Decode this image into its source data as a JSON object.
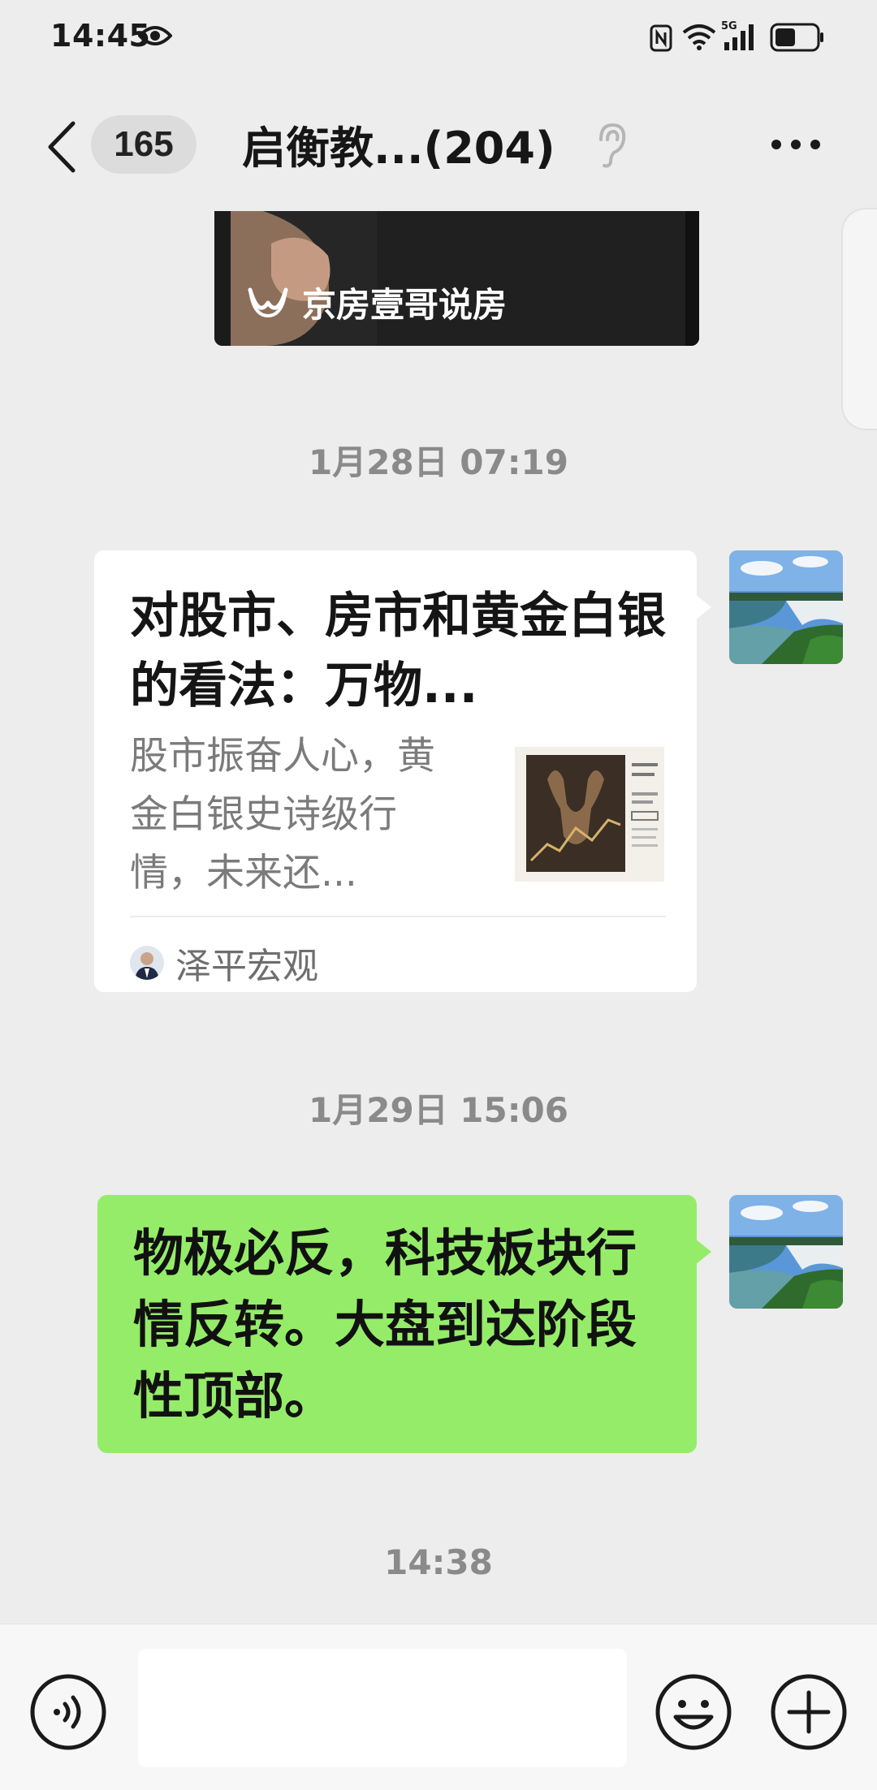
{
  "status_bar": {
    "time": "14:45",
    "network": "5G",
    "icons": [
      "eye-icon",
      "nfc-icon",
      "wifi-icon",
      "signal-icon",
      "battery-icon"
    ],
    "battery_level": 0.5
  },
  "header": {
    "unread_count": "165",
    "title": "启衡教...(204)",
    "icons": [
      "back-icon",
      "ear-icon",
      "more-icon"
    ]
  },
  "messages": {
    "video": {
      "channel_name": "京房壹哥说房",
      "icon": "channels-icon"
    },
    "time_1": "1月28日 07:19",
    "article": {
      "title": "对股市、房市和黄金白银的看法：万物...",
      "summary": "股市振奋人心，黄金白银史诗级行情，未来还...",
      "source": "泽平宏观"
    },
    "time_2": "1月29日 15:06",
    "text_message": "物极必反，科技板块行情反转。大盘到达阶段性顶部。",
    "time_3": "14:38"
  },
  "input_bar": {
    "icons": [
      "voice-icon",
      "emoji-icon",
      "plus-icon"
    ]
  },
  "colors": {
    "background": "#ededed",
    "bubble_green": "#95ec69",
    "card_white": "#ffffff",
    "timestamp_gray": "#8a8a8a"
  }
}
